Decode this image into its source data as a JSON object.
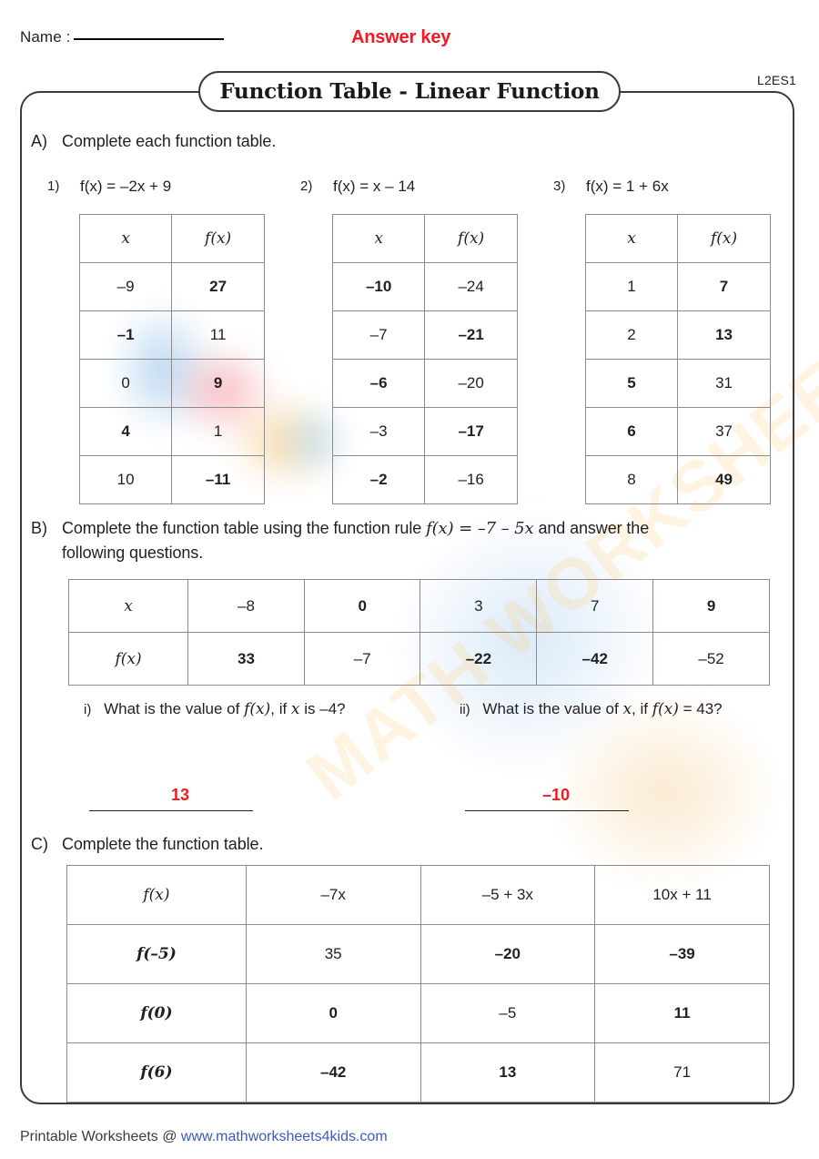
{
  "header": {
    "name_label": "Name :",
    "answer_key": "Answer key",
    "sheet_code": "L2ES1",
    "title": "Function Table - Linear Function"
  },
  "colors": {
    "answer_red": "#ED1C24",
    "text": "#231F20",
    "border": "#3B3B3B",
    "link": "#3B5BC0"
  },
  "sectionA": {
    "letter": "A)",
    "instruction": "Complete each function table.",
    "col_x": "x",
    "col_fx": "f(x)",
    "tables": [
      {
        "number": "1)",
        "rule": "f(x) = –2x + 9",
        "rows": [
          {
            "x": "–9",
            "x_red": false,
            "fx": "27",
            "fx_red": true
          },
          {
            "x": "–1",
            "x_red": true,
            "fx": "11",
            "fx_red": false
          },
          {
            "x": "0",
            "x_red": false,
            "fx": "9",
            "fx_red": true
          },
          {
            "x": "4",
            "x_red": true,
            "fx": "1",
            "fx_red": false
          },
          {
            "x": "10",
            "x_red": false,
            "fx": "–11",
            "fx_red": true
          }
        ]
      },
      {
        "number": "2)",
        "rule": "f(x) = x – 14",
        "rows": [
          {
            "x": "–10",
            "x_red": true,
            "fx": "–24",
            "fx_red": false
          },
          {
            "x": "–7",
            "x_red": false,
            "fx": "–21",
            "fx_red": true
          },
          {
            "x": "–6",
            "x_red": true,
            "fx": "–20",
            "fx_red": false
          },
          {
            "x": "–3",
            "x_red": false,
            "fx": "–17",
            "fx_red": true
          },
          {
            "x": "–2",
            "x_red": true,
            "fx": "–16",
            "fx_red": false
          }
        ]
      },
      {
        "number": "3)",
        "rule": "f(x) = 1 + 6x",
        "rows": [
          {
            "x": "1",
            "x_red": false,
            "fx": "7",
            "fx_red": true
          },
          {
            "x": "2",
            "x_red": false,
            "fx": "13",
            "fx_red": true
          },
          {
            "x": "5",
            "x_red": true,
            "fx": "31",
            "fx_red": false
          },
          {
            "x": "6",
            "x_red": true,
            "fx": "37",
            "fx_red": false
          },
          {
            "x": "8",
            "x_red": false,
            "fx": "49",
            "fx_red": true
          }
        ]
      }
    ]
  },
  "sectionB": {
    "letter": "B)",
    "instruction_part1": "Complete the function table using the function rule ",
    "rule": "f(x) = –7 – 5x",
    "instruction_part2": " and answer the",
    "instruction_line2": "following questions.",
    "row_labels": {
      "x": "x",
      "fx": "f(x)"
    },
    "x_values": [
      {
        "v": "–8",
        "red": false
      },
      {
        "v": "0",
        "red": true
      },
      {
        "v": "3",
        "red": false
      },
      {
        "v": "7",
        "red": false
      },
      {
        "v": "9",
        "red": true
      }
    ],
    "fx_values": [
      {
        "v": "33",
        "red": true
      },
      {
        "v": "–7",
        "red": false
      },
      {
        "v": "–22",
        "red": true
      },
      {
        "v": "–42",
        "red": true
      },
      {
        "v": "–52",
        "red": false
      }
    ],
    "questions": [
      {
        "num": "i)",
        "text_a": "What is the value of ",
        "sym_a": "f(x)",
        "text_b": ", if ",
        "sym_b": "x",
        "text_c": " is –4?",
        "answer": "13"
      },
      {
        "num": "ii)",
        "text_a": "What is the value of ",
        "sym_a": "x",
        "text_b": ", if ",
        "sym_b": "f(x)",
        "text_c": " = 43?",
        "answer": "–10"
      }
    ]
  },
  "sectionC": {
    "letter": "C)",
    "instruction": "Complete the function table.",
    "header": [
      {
        "v": "f(x)",
        "italic": true
      },
      {
        "v": "–7x",
        "italic": false
      },
      {
        "v": "–5 + 3x",
        "italic": false
      },
      {
        "v": "10x + 11",
        "italic": false
      }
    ],
    "rows": [
      {
        "label": "f(–5)",
        "label_red": true,
        "cells": [
          {
            "v": "35",
            "red": false
          },
          {
            "v": "–20",
            "red": true
          },
          {
            "v": "–39",
            "red": true
          }
        ]
      },
      {
        "label": "f(0)",
        "label_red": true,
        "cells": [
          {
            "v": "0",
            "red": true
          },
          {
            "v": "–5",
            "red": false
          },
          {
            "v": "11",
            "red": true
          }
        ]
      },
      {
        "label": "f(6)",
        "label_red": true,
        "cells": [
          {
            "v": "–42",
            "red": true
          },
          {
            "v": "13",
            "red": true
          },
          {
            "v": "71",
            "red": false
          }
        ]
      }
    ]
  },
  "footer": {
    "prefix": "Printable Worksheets @ ",
    "url": "www.mathworksheets4kids.com"
  },
  "watermark": {
    "text": "MATH WORKSHEETS"
  }
}
